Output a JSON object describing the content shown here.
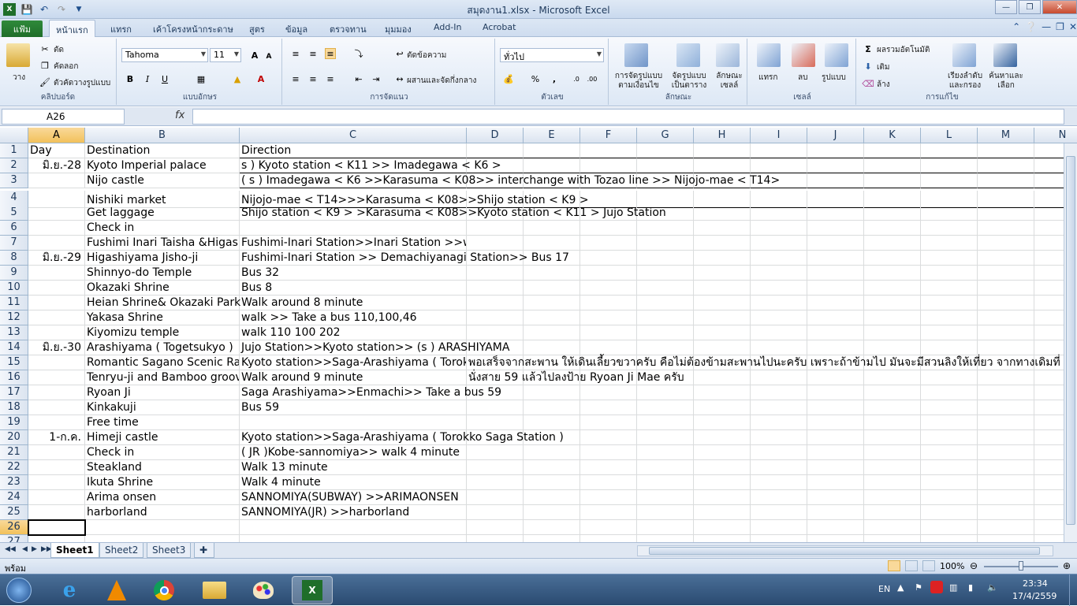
{
  "window": {
    "title": "สมุดงาน1.xlsx - Microsoft Excel"
  },
  "ribbon_tabs": {
    "file": "แฟ้ม",
    "items": [
      "หน้าแรก",
      "แทรก",
      "เค้าโครงหน้ากระดาษ",
      "สูตร",
      "ข้อมูล",
      "ตรวจทาน",
      "มุมมอง",
      "Add-In",
      "Acrobat"
    ],
    "active": "หน้าแรก"
  },
  "ribbon": {
    "clipboard": {
      "paste": "วาง",
      "cut": "ตัด",
      "copy": "คัดลอก",
      "format_painter": "ตัวคัดวางรูปแบบ",
      "label": "คลิปบอร์ด"
    },
    "font": {
      "name": "Tahoma",
      "size": "11",
      "bold": "B",
      "italic": "I",
      "underline": "U",
      "label": "แบบอักษร"
    },
    "alignment": {
      "wrap": "ตัดข้อความ",
      "merge": "ผสานและจัดกึ่งกลาง",
      "label": "การจัดแนว"
    },
    "number": {
      "format": "ทั่วไป",
      "percent": "%",
      "comma": ",",
      "label": "ตัวเลข"
    },
    "styles": {
      "conditional": "การจัดรูปแบบ ตามเงื่อนไข",
      "as_table": "จัดรูปแบบ เป็นตาราง",
      "cell_styles": "ลักษณะ เซลล์",
      "label": "ลักษณะ"
    },
    "cells": {
      "insert": "แทรก",
      "delete": "ลบ",
      "format": "รูปแบบ",
      "label": "เซลล์"
    },
    "editing": {
      "autosum": "ผลรวมอัตโนมัติ",
      "fill": "เติม",
      "clear": "ล้าง",
      "sort": "เรียงลำดับ และกรอง",
      "find": "ค้นหาและ เลือก",
      "label": "การแก้ไข"
    }
  },
  "formula_bar": {
    "name_box": "A26",
    "fx": "fx",
    "formula": ""
  },
  "columns": [
    "A",
    "B",
    "C",
    "D",
    "E",
    "F",
    "G",
    "H",
    "I",
    "J",
    "K",
    "L",
    "M",
    "N"
  ],
  "rows": [
    {
      "n": "1",
      "A": "Day",
      "B": "Destination",
      "C": "Direction"
    },
    {
      "n": "2",
      "A": "มิ.ย.-28",
      "B": "Kyoto Imperial palace",
      "C": " s ) Kyoto station < K11 >> Imadegawa < K6 >"
    },
    {
      "n": "3",
      "A": "",
      "B": "Nijo castle",
      "C": "( s ) Imadegawa < K6 >>Karasuma < K08>>  interchange with Tozao line >> Nijojo-mae < T14>"
    },
    {
      "n": "4",
      "A": "",
      "B": "Nishiki market",
      "C": "Nijojo-mae < T14>>>Karasuma < K08>>Shijo station < K9 >"
    },
    {
      "n": "5",
      "A": "",
      "B": "Get laggage",
      "C": "Shijo station < K9 > >Karasuma < K08>>Kyoto station < K11 > Jujo Station"
    },
    {
      "n": "6",
      "A": "",
      "B": "Check in",
      "C": ""
    },
    {
      "n": "7",
      "A": "",
      "B": "Fushimi Inari Taisha &Higashi",
      "C": "Fushimi-Inari Station>>Inari Station >>walk"
    },
    {
      "n": "8",
      "A": "มิ.ย.-29",
      "B": "Higashiyama Jisho-ji",
      "C": "Fushimi-Inari Station >> Demachiyanagi Station>> Bus 17"
    },
    {
      "n": "9",
      "A": "",
      "B": "Shinnyo-do Temple",
      "C": "Bus 32"
    },
    {
      "n": "10",
      "A": "",
      "B": " Okazaki Shrine",
      "C": "Bus 8"
    },
    {
      "n": "11",
      "A": "",
      "B": "Heian Shrine&  Okazaki Park",
      "C": "Walk  around 8 minute"
    },
    {
      "n": "12",
      "A": "",
      "B": "Yakasa Shrine",
      "C": "walk >> Take a bus 110,100,46"
    },
    {
      "n": "13",
      "A": "",
      "B": "Kiyomizu temple",
      "C": "walk 110 100 202"
    },
    {
      "n": "14",
      "A": "มิ.ย.-30",
      "B": "Arashiyama ( Togetsukyo )",
      "C": "Jujo Station>>Kyoto station>> (s ) ARASHIYAMA"
    },
    {
      "n": "15",
      "A": "",
      "B": "Romantic Sagano Scenic Railw",
      "C": "Kyoto station>>Saga-Arashiyama ( Torokko",
      "D": "พอเสร็จจากสะพาน ให้เดินเลี้ยวขวาครับ คือไม่ต้องข้ามสะพานไปนะครับ เพราะถ้าข้ามไป มันจะมีสวนลิงให้เที่ยว จากทางเดิมที่"
    },
    {
      "n": "16",
      "A": "",
      "B": "Tenryu-ji and Bamboo groove",
      "C": "Walk around 9 minute",
      "D": "นั่งสาย 59 แล้วไปลงป้าย Ryoan Ji Mae ครับ"
    },
    {
      "n": "17",
      "A": "",
      "B": "Ryoan Ji",
      "C": " Saga Arashiyama>>Enmachi>> Take a bus 59"
    },
    {
      "n": "18",
      "A": "",
      "B": "Kinkakuji",
      "C": "Bus 59"
    },
    {
      "n": "19",
      "A": "",
      "B": "Free time",
      "C": ""
    },
    {
      "n": "20",
      "A": "1-ก.ค.",
      "B": "Himeji castle",
      "C": "Kyoto station>>Saga-Arashiyama ( Torokko Saga Station )"
    },
    {
      "n": "21",
      "A": "",
      "B": "Check in",
      "C": "( JR )Kobe-sannomiya>> walk 4 minute"
    },
    {
      "n": "22",
      "A": "",
      "B": "Steakland",
      "C": "Walk 13 minute"
    },
    {
      "n": "23",
      "A": "",
      "B": "Ikuta Shrine",
      "C": "Walk 4 minute"
    },
    {
      "n": "24",
      "A": "",
      "B": "Arima onsen",
      "C": "SANNOMIYA(SUBWAY) >>ARIMAONSEN"
    },
    {
      "n": "25",
      "A": "",
      "B": "harborland",
      "C": "SANNOMIYA(JR)  >>harborland"
    },
    {
      "n": "26",
      "A": "",
      "B": "",
      "C": ""
    },
    {
      "n": "27",
      "A": "",
      "B": "",
      "C": ""
    }
  ],
  "sheets": [
    "Sheet1",
    "Sheet2",
    "Sheet3"
  ],
  "active_sheet": "Sheet1",
  "status": {
    "ready": "พร้อม",
    "zoom": "100%"
  },
  "taskbar": {
    "lang": "EN",
    "time": "23:34",
    "date": "17/4/2559"
  }
}
